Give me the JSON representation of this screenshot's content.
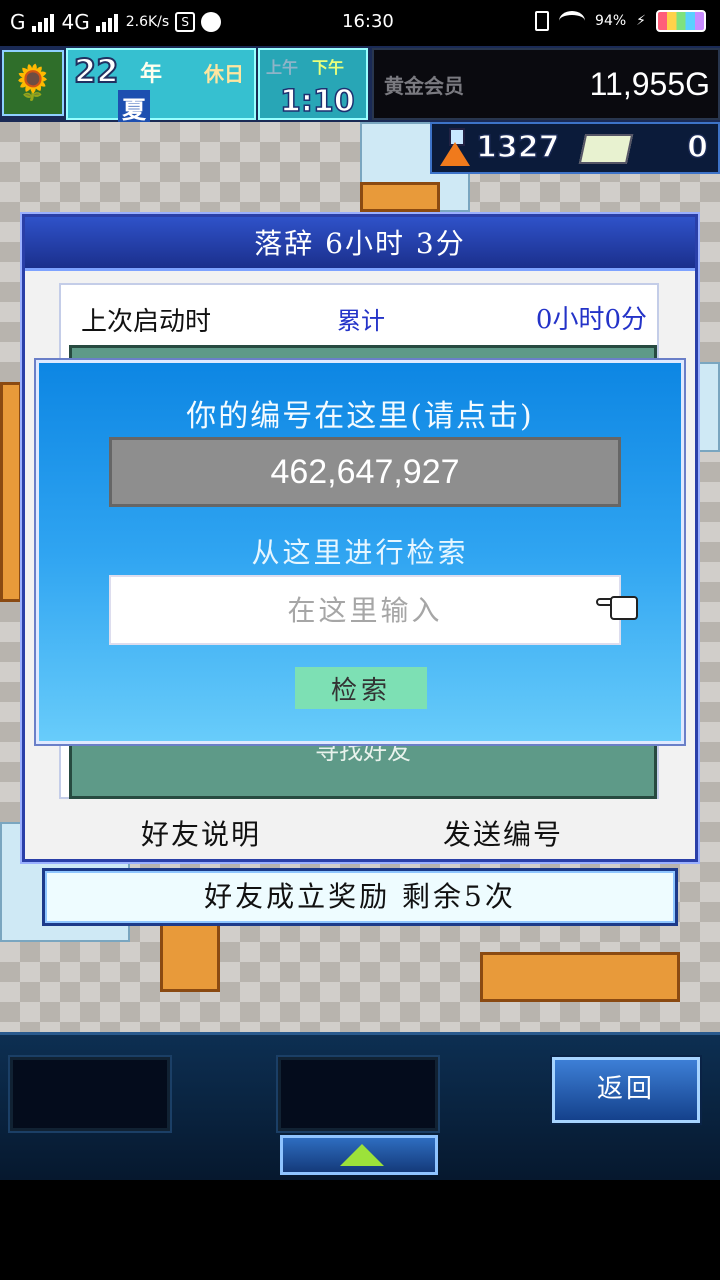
{
  "status_bar": {
    "carrier": "G",
    "network": "4G",
    "speed": "2.6K/s",
    "time": "16:30",
    "battery": "94%"
  },
  "hud": {
    "year_number": "22",
    "year_label": "年",
    "holiday": "休日",
    "month": "夏",
    "am_label": "上午",
    "pm_label": "下午",
    "time": "1:10",
    "gold_label": "黄金会员",
    "gold": "11,955G",
    "research_points": "1327",
    "tickets": "0"
  },
  "dialog": {
    "title": "落辞 6小时 3分",
    "stat_label": "上次启动时",
    "stat_total_label": "累计",
    "stat_value": "0小时0分",
    "behind_text": "寻找好友",
    "link_left": "好友说明",
    "link_right": "发送编号"
  },
  "popup": {
    "title": "你的编号在这里(请点击)",
    "player_id": "462,647,927",
    "search_label": "从这里进行检索",
    "search_placeholder": "在这里输入",
    "search_value": "",
    "search_button": "检索"
  },
  "reward_bar": "好友成立奖励 剩余5次",
  "bottom": {
    "back_label": "返回"
  },
  "colors": {
    "popup_top": "#0d86e3",
    "popup_bottom": "#68ccfa",
    "dialog_title": "#2f52c9",
    "search_button": "#7de0b4",
    "link_blue": "#2433c8"
  }
}
